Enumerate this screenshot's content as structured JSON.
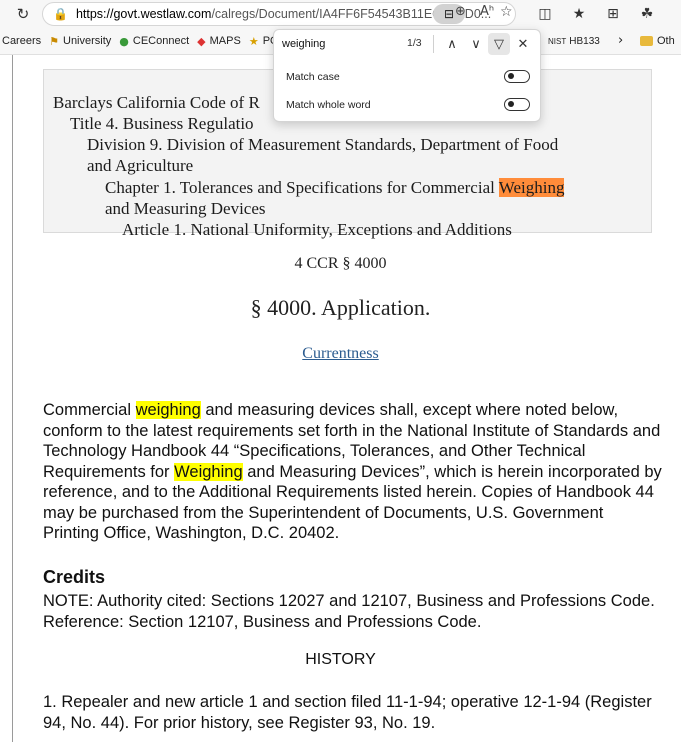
{
  "browser": {
    "url_domain": "https://govt.westlaw.com",
    "url_path": "/calregs/Document/IA4FF6F54543B11ECAE2D0...",
    "icons": {
      "refresh": "refresh-icon",
      "lock": "lock-icon",
      "reader": "immersive-reader-icon",
      "zoom": "zoom-icon",
      "read_aloud": "read-aloud-icon",
      "favorite": "favorite-star-icon",
      "split": "split-screen-icon",
      "favorites_bar": "favorites-icon",
      "collections": "collections-icon",
      "extensions": "extensions-icon"
    }
  },
  "bookmarks": {
    "items": [
      {
        "label": "Careers"
      },
      {
        "label": "University"
      },
      {
        "label": "CEConnect"
      },
      {
        "label": "MAPS"
      },
      {
        "label": "PORTA"
      }
    ],
    "right_item": "HB133",
    "right_prefix": "NIST",
    "overflow": "Oth"
  },
  "find": {
    "query": "weighing",
    "count": "1/3",
    "options": [
      {
        "label": "Match case",
        "enabled": false
      },
      {
        "label": "Match whole word",
        "enabled": false
      }
    ]
  },
  "toc": {
    "line1": "Barclays California Code of R",
    "line2": "Title 4. Business Regulatio",
    "line3": "Division 9. Division of Measurement Standards, Department of Food",
    "line4": "and Agriculture",
    "line5a": "Chapter 1. Tolerances and Specifications for Commercial ",
    "line5b": "Weighing",
    "line6": "and Measuring Devices",
    "line7": "Article 1. National Uniformity, Exceptions and Additions"
  },
  "document": {
    "citation": "4 CCR § 4000",
    "section_title": "§ 4000. Application.",
    "currentness": "Currentness",
    "body_p1a": "Commercial ",
    "body_hl1": "weighing",
    "body_p1b": " and measuring devices shall, except where noted below, conform to the latest requirements set forth in the National Institute of Standards and Technology Handbook 44 “Specifications, Tolerances, and Other Technical Requirements for ",
    "body_hl2": "Weighing",
    "body_p1c": " and Measuring Devices”, which is herein incorporated by reference, and to the Additional Requirements listed herein. Copies of Handbook 44 may be purchased from the Superintendent of Documents, U.S. Government Printing Office, Washington, D.C. 20402.",
    "credits_heading": "Credits",
    "credits_note": "NOTE: Authority cited: Sections 12027 and 12107, Business and Professions Code. Reference: Section 12107, Business and Professions Code.",
    "history_heading": "HISTORY",
    "history_item": "1. Repealer and new article 1 and section filed 11-1-94; operative 12-1-94 (Register 94, No. 44). For prior history, see Register 93, No. 19."
  },
  "colors": {
    "highlight": "#ffff00",
    "current_match": "#ff8c3a",
    "link": "#2b5b8f"
  }
}
